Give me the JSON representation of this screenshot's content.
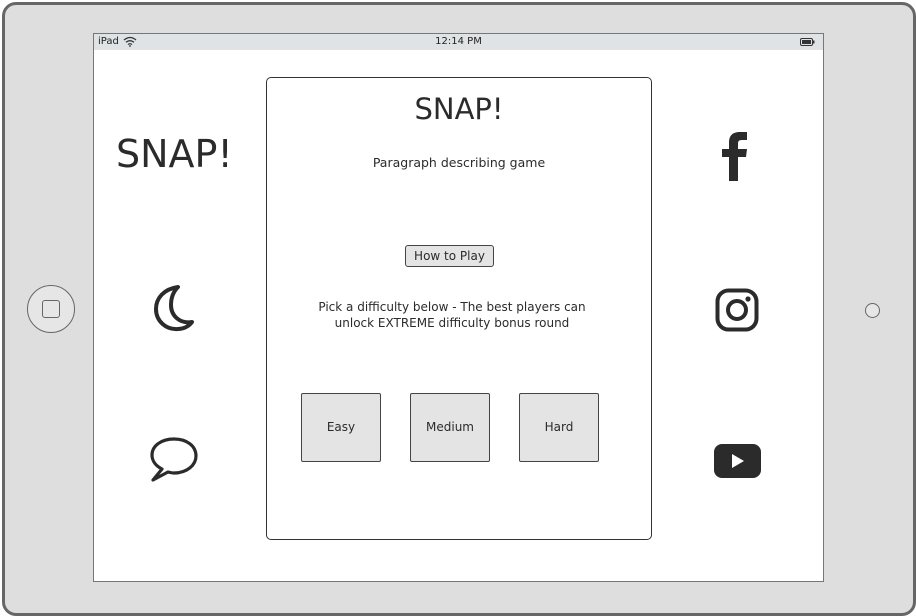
{
  "status_bar": {
    "device": "iPad",
    "time": "12:14 PM",
    "icons": [
      "wifi-icon",
      "battery-icon"
    ]
  },
  "left_panel": {
    "logo": "SNAP!",
    "icons": [
      "moon-icon",
      "chat-bubble-icon"
    ]
  },
  "card": {
    "title": "SNAP!",
    "description": "Paragraph describing game",
    "how_to_play_label": "How to Play",
    "instructions_line1": "Pick a difficulty below - The best players can",
    "instructions_line2": "unlock EXTREME difficulty bonus round",
    "difficulties": [
      "Easy",
      "Medium",
      "Hard"
    ]
  },
  "right_panel": {
    "icons": [
      "facebook-icon",
      "instagram-icon",
      "youtube-icon"
    ]
  },
  "colors": {
    "ink": "#2b2b2b",
    "button_fill": "#e4e4e4",
    "status_bar": "#dfe3e5",
    "device_frame": "#dedede"
  }
}
